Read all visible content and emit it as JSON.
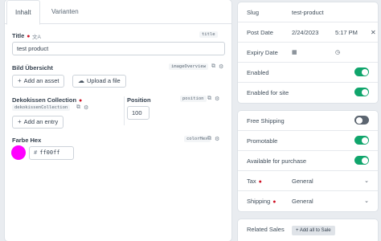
{
  "tabs": [
    {
      "label": "Inhalt",
      "active": true
    },
    {
      "label": "Varianten",
      "active": false
    }
  ],
  "title_field": {
    "label": "Title",
    "handle": "title",
    "value": "test product",
    "required": true
  },
  "image_field": {
    "label": "Bild Übersicht",
    "handle": "imageOverview",
    "add_asset": "Add an asset",
    "upload": "Upload a file"
  },
  "collection_field": {
    "label": "Dekokissen Collection",
    "handle_main": "dekokissenCollection",
    "required": true,
    "add_entry": "Add an entry"
  },
  "position_field": {
    "label": "Position",
    "handle": "position",
    "value": "100"
  },
  "color_field": {
    "label": "Farbe Hex",
    "handle": "colorHex",
    "value": "ff00ff",
    "hash": "#",
    "swatch": "#ff00ff"
  },
  "meta": {
    "slug_label": "Slug",
    "slug_value": "test-product",
    "post_date_label": "Post Date",
    "post_date": "2/24/2023",
    "post_time": "5:17 PM",
    "expiry_label": "Expiry Date",
    "enabled_label": "Enabled",
    "enabled": true,
    "enabled_site_label": "Enabled for site",
    "enabled_site": true
  },
  "commerce": {
    "free_shipping_label": "Free Shipping",
    "free_shipping": false,
    "promotable_label": "Promotable",
    "promotable": true,
    "available_label": "Available for purchase",
    "available": true,
    "tax_label": "Tax",
    "tax_value": "General",
    "shipping_label": "Shipping",
    "shipping_value": "General"
  },
  "sales": {
    "label": "Related Sales",
    "button": "Add all to Sale"
  },
  "colors": {
    "toggle_on": "#10a56c",
    "toggle_off": "#5c6570",
    "required": "#cf1124"
  }
}
